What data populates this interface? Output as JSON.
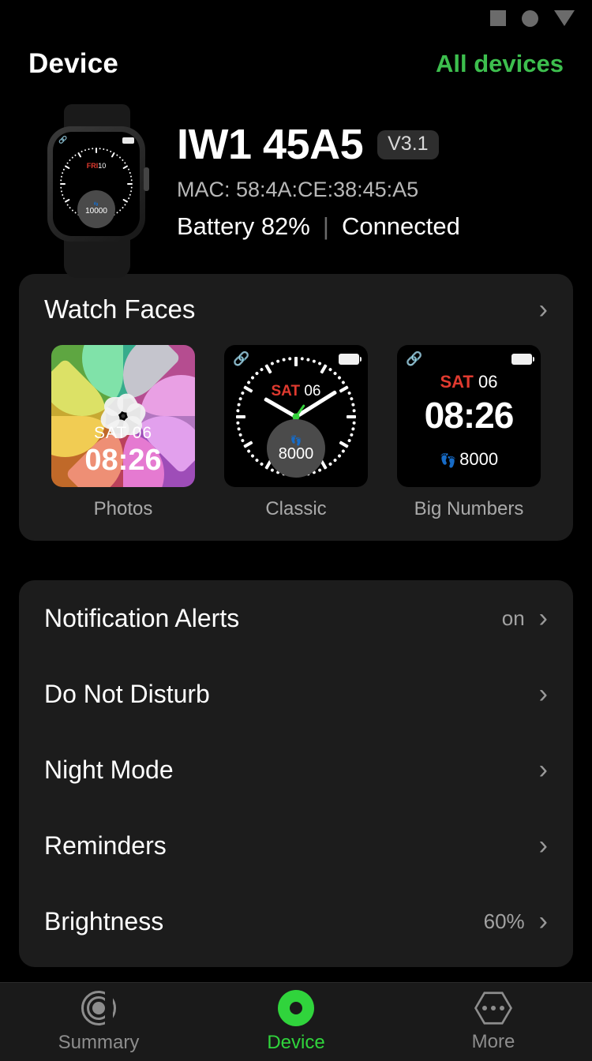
{
  "statusbar": {
    "icons": [
      "square-icon",
      "circle-icon",
      "triangle-down-icon"
    ]
  },
  "header": {
    "title": "Device",
    "all_devices": "All devices"
  },
  "device": {
    "name": "IW1 45A5",
    "version_badge": "V3.1",
    "mac": "MAC: 58:4A:CE:38:45:A5",
    "battery": "Battery 82%",
    "separator": "|",
    "connection": "Connected",
    "preview_face": {
      "day": "FRI",
      "date": "10",
      "steps": "10000"
    }
  },
  "watch_faces": {
    "title": "Watch Faces",
    "chevron": "›",
    "items": [
      {
        "label": "Photos",
        "day": "SAT",
        "date": "06",
        "time": "08:26",
        "style": "photos"
      },
      {
        "label": "Classic",
        "day": "SAT",
        "date": "06",
        "steps": "8000",
        "steps_icon": "footprints-icon",
        "style": "classic"
      },
      {
        "label": "Big Numbers",
        "day": "SAT",
        "date": "06",
        "time": "08:26",
        "steps": "8000",
        "steps_icon": "footprints-icon",
        "style": "big-numbers"
      }
    ]
  },
  "settings": {
    "rows": [
      {
        "label": "Notification Alerts",
        "value": "on",
        "chevron": "›"
      },
      {
        "label": "Do Not Disturb",
        "value": "",
        "chevron": "›"
      },
      {
        "label": "Night Mode",
        "value": "",
        "chevron": "›"
      },
      {
        "label": "Reminders",
        "value": "",
        "chevron": "›"
      },
      {
        "label": "Brightness",
        "value": "60%",
        "chevron": "›"
      }
    ]
  },
  "tabbar": {
    "tabs": [
      {
        "label": "Summary",
        "icon": "target-rings-icon",
        "active": false
      },
      {
        "label": "Device",
        "icon": "device-dot-icon",
        "active": true
      },
      {
        "label": "More",
        "icon": "hexagon-ellipsis-icon",
        "active": false
      }
    ]
  },
  "colors": {
    "accent_green": "#30d43c",
    "link_green": "#3dbf4e",
    "card_bg": "#1c1c1c",
    "background": "#000000",
    "muted_text": "#a2a2a2",
    "date_red": "#e03a2f"
  }
}
